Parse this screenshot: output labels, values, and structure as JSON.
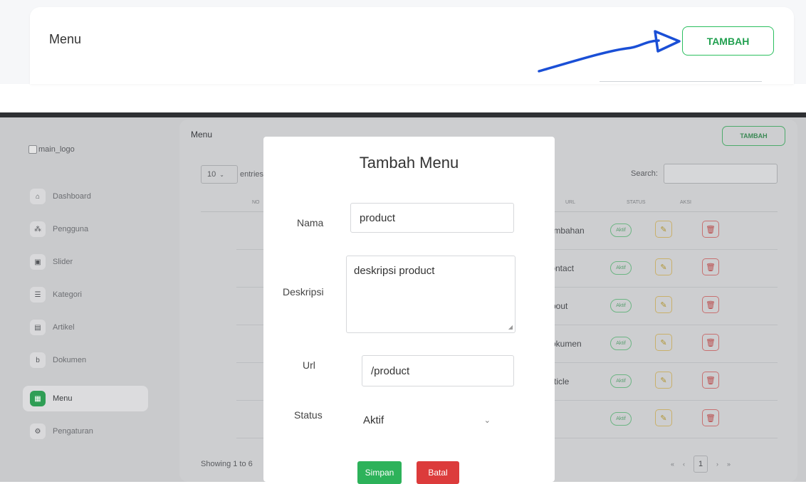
{
  "zoom": {
    "title": "Menu",
    "add_label": "TAMBAH"
  },
  "sidebar": {
    "logo_alt": "main_logo",
    "items": [
      {
        "label": "Dashboard",
        "icon": "home-icon",
        "glyph": "⌂"
      },
      {
        "label": "Pengguna",
        "icon": "users-icon",
        "glyph": "👥"
      },
      {
        "label": "Slider",
        "icon": "image-icon",
        "glyph": "▣"
      },
      {
        "label": "Kategori",
        "icon": "list-icon",
        "glyph": "☰"
      },
      {
        "label": "Artikel",
        "icon": "article-icon",
        "glyph": "▤"
      },
      {
        "label": "Dokumen",
        "icon": "document-icon",
        "glyph": "b"
      },
      {
        "label": "Menu",
        "icon": "menu-icon",
        "glyph": "▦"
      },
      {
        "label": "Pengaturan",
        "icon": "settings-icon",
        "glyph": "⚙"
      }
    ],
    "active": "Menu"
  },
  "main": {
    "title": "Menu",
    "add_label": "TAMBAH",
    "length_value": "10",
    "length_suffix": "entries",
    "search_label": "Search:",
    "columns": {
      "no": "NO",
      "url": "URL",
      "status": "STATUS",
      "aksi": "AKSI"
    },
    "rows": [
      {
        "url": "/tambahan",
        "status": "Aktif"
      },
      {
        "url": "/contact",
        "status": "Aktif"
      },
      {
        "url": "/about",
        "status": "Aktif"
      },
      {
        "url": "/dokumen",
        "status": "Aktif"
      },
      {
        "url": "/article",
        "status": "Aktif"
      },
      {
        "url": "/",
        "status": "Aktif"
      }
    ],
    "showing": "Showing 1 to 6",
    "pager": {
      "first": "«",
      "prev": "‹",
      "page": "1",
      "next": "›",
      "last": "»"
    }
  },
  "modal": {
    "title": "Tambah Menu",
    "nama_label": "Nama",
    "nama_value": "product",
    "deskripsi_label": "Deskripsi",
    "deskripsi_value": "deskripsi product",
    "url_label": "Url",
    "url_value": "/product",
    "status_label": "Status",
    "status_value": "Aktif",
    "save_label": "Simpan",
    "cancel_label": "Batal"
  },
  "colors": {
    "accent_green": "#2db25a",
    "danger_red": "#dc3b3b",
    "annotation_blue": "#1a4fd6"
  }
}
